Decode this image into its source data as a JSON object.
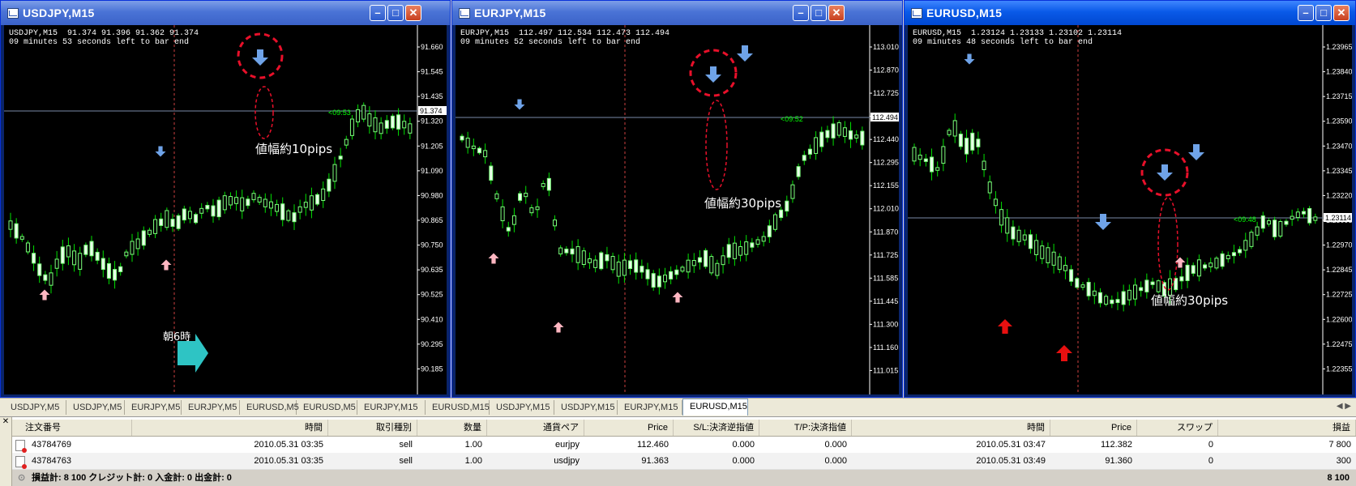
{
  "windows": [
    {
      "title": "USDJPY,M15",
      "info1": "USDJPY,M15  91.374 91.396 91.362 91.374",
      "info2": "09 minutes 53 seconds left to bar end",
      "timer": "<09:53",
      "current_price": "91.374",
      "price_scale": [
        "91.660",
        "91.545",
        "91.435",
        "91.320",
        "91.205",
        "91.090",
        "90.980",
        "90.865",
        "90.750",
        "90.635",
        "90.525",
        "90.410",
        "90.295",
        "90.185"
      ],
      "annotations": [
        "値幅約10pips",
        "朝6時"
      ]
    },
    {
      "title": "EURJPY,M15",
      "info1": "EURJPY,M15  112.497 112.534 112.473 112.494",
      "info2": "09 minutes 52 seconds left to bar end",
      "timer": "<09:52",
      "current_price": "112.494",
      "price_scale": [
        "113.010",
        "112.870",
        "112.725",
        "112.585",
        "112.440",
        "112.295",
        "112.155",
        "112.010",
        "111.870",
        "111.725",
        "111.585",
        "111.445",
        "111.300",
        "111.160",
        "111.015"
      ],
      "annotations": [
        "値幅約30pips"
      ]
    },
    {
      "title": "EURUSD,M15",
      "info1": "EURUSD,M15  1.23124 1.23133 1.23102 1.23114",
      "info2": "09 minutes 48 seconds left to bar end",
      "timer": "<09:48",
      "current_price": "1.23114",
      "price_scale": [
        "1.23965",
        "1.23840",
        "1.23715",
        "1.23590",
        "1.23470",
        "1.23345",
        "1.23220",
        "1.23095",
        "1.22970",
        "1.22845",
        "1.22725",
        "1.22600",
        "1.22475",
        "1.22355"
      ],
      "annotations": [
        "値幅約30pips"
      ]
    }
  ],
  "tabs": [
    "USDJPY,M5",
    "USDJPY,M5",
    "EURJPY,M5",
    "EURJPY,M5",
    "EURUSD,M5",
    "EURUSD,M5",
    "EURJPY,M15",
    "EURUSD,M15",
    "USDJPY,M15",
    "USDJPY,M15",
    "EURJPY,M15",
    "EURUSD,M15"
  ],
  "active_tab": 11,
  "terminal": {
    "headers": [
      "注文番号",
      "時間",
      "取引種別",
      "数量",
      "通貨ペア",
      "Price",
      "S/L:決済逆指値",
      "T/P:決済指値",
      "時間",
      "Price",
      "スワップ",
      "損益"
    ],
    "rows": [
      [
        "43784769",
        "2010.05.31 03:35",
        "sell",
        "1.00",
        "eurjpy",
        "112.460",
        "0.000",
        "0.000",
        "2010.05.31 03:47",
        "112.382",
        "0",
        "7 800"
      ],
      [
        "43784763",
        "2010.05.31 03:35",
        "sell",
        "1.00",
        "usdjpy",
        "91.363",
        "0.000",
        "0.000",
        "2010.05.31 03:49",
        "91.360",
        "0",
        "300"
      ]
    ],
    "summary": "損益計: 8 100  クレジット計: 0  入金計: 0  出金計: 0",
    "summary_total": "8 100"
  },
  "colors": {
    "candle": "#7cff7c",
    "down": "#00c800",
    "arrow_down": "#6fa3e8",
    "arrow_up": "#ffb6c1",
    "annotation_circle": "#e8102a",
    "teal": "#2ec4c4"
  }
}
